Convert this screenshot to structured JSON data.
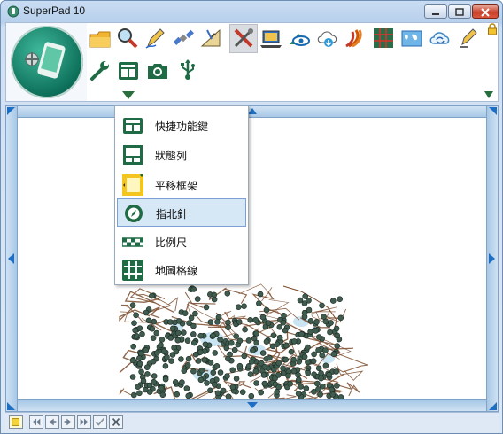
{
  "window": {
    "title": "SuperPad 10"
  },
  "ribbon": {
    "row1": [
      "folder-icon",
      "search-icon",
      "pen-icon",
      "satellite-icon",
      "ruler-icon",
      "tools-icon",
      "laptop-icon",
      "eye-map-icon",
      "cloud-download-icon",
      "signal-icon",
      "grid-map-icon",
      "world-map-icon",
      "cloud-sync-icon",
      "edit-pen-icon"
    ],
    "row2": [
      "wrench-icon",
      "panel-icon",
      "camera-icon",
      "usb-icon"
    ]
  },
  "menu": {
    "items": [
      {
        "label": "快捷功能鍵",
        "icon": "shortcut-keys-icon",
        "selected": false
      },
      {
        "label": "狀態列",
        "icon": "status-bar-icon",
        "selected": false
      },
      {
        "label": "平移框架",
        "icon": "pan-frame-icon",
        "selected": false
      },
      {
        "label": "指北針",
        "icon": "compass-icon",
        "selected": true
      },
      {
        "label": "比例尺",
        "icon": "scale-bar-icon",
        "selected": false
      },
      {
        "label": "地圖格線",
        "icon": "map-grid-icon",
        "selected": false
      }
    ]
  },
  "colors": {
    "accent_green": "#1f6b45",
    "menu_selected": "#d6e8f6",
    "map_points": "#3f5c4f",
    "map_roads": "#7a4a2a",
    "map_water": "#c9e4f2"
  }
}
